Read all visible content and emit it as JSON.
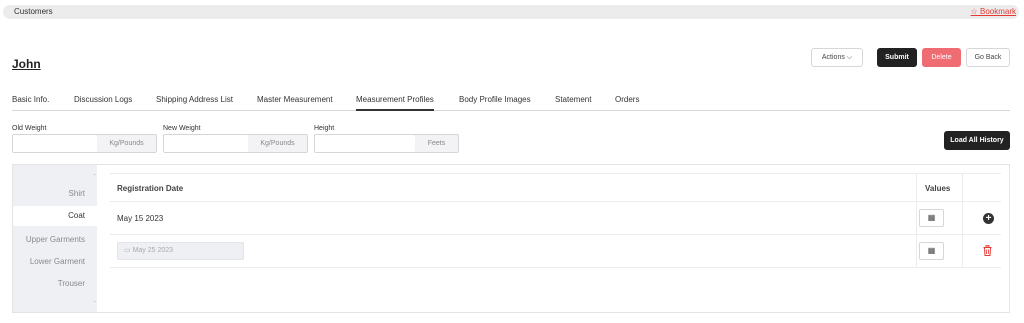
{
  "breadcrumb": {
    "title": "Customers",
    "bookmark": "☆ Bookmark"
  },
  "customer_name": "John",
  "header_buttons": {
    "actions": "Actions ⌵",
    "submit": "Submit",
    "delete": "Delete",
    "go_back": "Go Back"
  },
  "tabs": [
    {
      "label": "Basic Info."
    },
    {
      "label": "Discussion Logs"
    },
    {
      "label": "Shipping Address List"
    },
    {
      "label": "Master Measurement"
    },
    {
      "label": "Measurement Profiles"
    },
    {
      "label": "Body Profile Images"
    },
    {
      "label": "Statement"
    },
    {
      "label": "Orders"
    }
  ],
  "active_tab": "Measurement Profiles",
  "fields": {
    "old_weight": {
      "label": "Old Weight",
      "value": "",
      "unit": "Kg/Pounds"
    },
    "new_weight": {
      "label": "New Weight",
      "value": "",
      "unit": "Kg/Pounds"
    },
    "height": {
      "label": "Height",
      "value": "",
      "unit": "Feets"
    }
  },
  "load_history_label": "Load All History",
  "sidebar": {
    "items": [
      {
        "label": "Shirt"
      },
      {
        "label": "Coat"
      },
      {
        "label": "Upper Garments"
      },
      {
        "label": "Lower Garment"
      },
      {
        "label": "Trouser"
      }
    ],
    "active": "Coat"
  },
  "table": {
    "headers": {
      "date": "Registration Date",
      "values": "Values"
    },
    "rows": [
      {
        "date": "May 15 2023",
        "values_icon": "grid-icon",
        "action_icon": "plus-circle-icon"
      },
      {
        "date_placeholder": "May 25 2023",
        "values_icon": "grid-icon",
        "action_icon": "trash-icon"
      }
    ]
  },
  "colors": {
    "primary": "#222222",
    "danger": "#ef6c73",
    "link": "#e53935",
    "sidebar_bg": "#eef0f4"
  }
}
